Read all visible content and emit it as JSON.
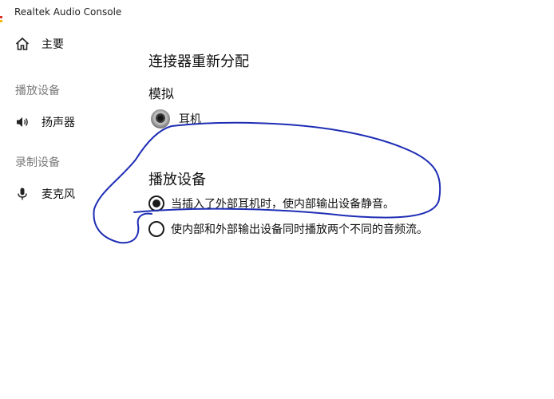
{
  "window": {
    "title": "Realtek Audio Console"
  },
  "sidebar": {
    "home": {
      "label": "主要",
      "icon": "home-icon"
    },
    "playback_section": "播放设备",
    "speaker": {
      "label": "扬声器",
      "icon": "speaker-icon"
    },
    "recording_section": "录制设备",
    "microphone": {
      "label": "麦克风",
      "icon": "microphone-icon"
    }
  },
  "main": {
    "title": "连接器重新分配",
    "analog_heading": "模拟",
    "device": {
      "label": "耳机",
      "icon": "headphone-jack-icon"
    },
    "playback_heading": "播放设备",
    "options": [
      {
        "label": "当插入了外部耳机时，使内部输出设备静音。",
        "checked": true
      },
      {
        "label": "使内部和外部输出设备同时播放两个不同的音频流。",
        "checked": false
      }
    ]
  },
  "colors": {
    "annotation": "#1e2db4",
    "accent_red": "#d93025",
    "accent_yellow": "#f2b705"
  }
}
